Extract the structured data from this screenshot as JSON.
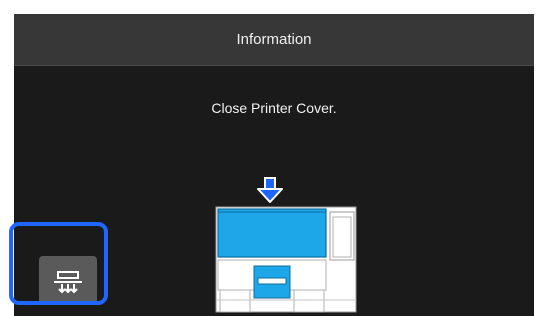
{
  "header": {
    "title": "Information"
  },
  "message": {
    "text": "Close Printer Cover."
  },
  "illustration": {
    "name": "printer-cover-close-illustration",
    "accent_color": "#1ea7e8",
    "arrow_color": "#1f66ff"
  },
  "controls": {
    "cover_button_icon": "printer-cover-icon"
  },
  "highlight": {
    "color": "#1f66ff"
  }
}
